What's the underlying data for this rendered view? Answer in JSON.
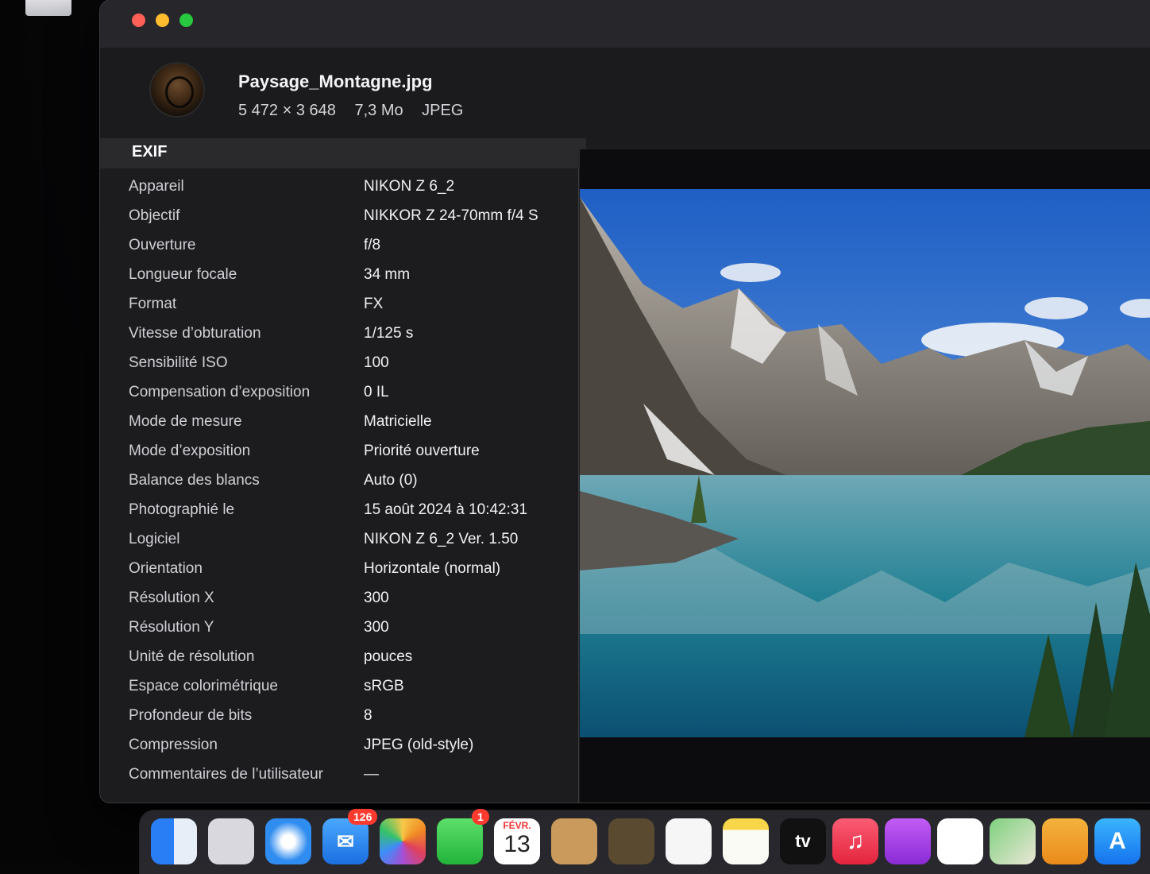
{
  "file": {
    "name": "Paysage_Montagne.jpg",
    "dimensions": "5 472 × 3 648",
    "size": "7,3 Mo",
    "format": "JPEG"
  },
  "exif": {
    "section_title": "EXIF",
    "rows": [
      {
        "label": "Appareil",
        "value": "NIKON Z 6_2"
      },
      {
        "label": "Objectif",
        "value": "NIKKOR Z 24-70mm f/4 S"
      },
      {
        "label": "Ouverture",
        "value": "f/8"
      },
      {
        "label": "Longueur focale",
        "value": "34 mm"
      },
      {
        "label": "Format",
        "value": "FX"
      },
      {
        "label": "Vitesse d’obturation",
        "value": "1/125 s"
      },
      {
        "label": "Sensibilité ISO",
        "value": "100"
      },
      {
        "label": "Compensation d’exposition",
        "value": "0 IL"
      },
      {
        "label": "Mode de mesure",
        "value": "Matricielle"
      },
      {
        "label": "Mode d’exposition",
        "value": "Priorité ouverture"
      },
      {
        "label": "Balance des blancs",
        "value": "Auto (0)"
      },
      {
        "label": "Photographié le",
        "value": "15 août 2024 à 10:42:31"
      },
      {
        "label": "Logiciel",
        "value": "NIKON Z 6_2 Ver. 1.50"
      },
      {
        "label": "Orientation",
        "value": "Horizontale (normal)"
      },
      {
        "label": "Résolution X",
        "value": "300"
      },
      {
        "label": "Résolution Y",
        "value": "300"
      },
      {
        "label": "Unité de résolution",
        "value": "pouces"
      },
      {
        "label": "Espace colorimétrique",
        "value": "sRGB"
      },
      {
        "label": "Profondeur de bits",
        "value": "8"
      },
      {
        "label": "Compression",
        "value": "JPEG (old-style)"
      },
      {
        "label": "Commentaires de l’utilisateur",
        "value": "—"
      }
    ]
  },
  "dock": {
    "mail_badge": "126",
    "facetime_badge": "1",
    "calendar_month": "FÉVR.",
    "calendar_day": "13",
    "tv_label": "tv"
  },
  "colors": {
    "window_bg": "#1d1d20",
    "close": "#fe5f57",
    "minimize": "#febc2e",
    "maximize": "#28c840"
  }
}
